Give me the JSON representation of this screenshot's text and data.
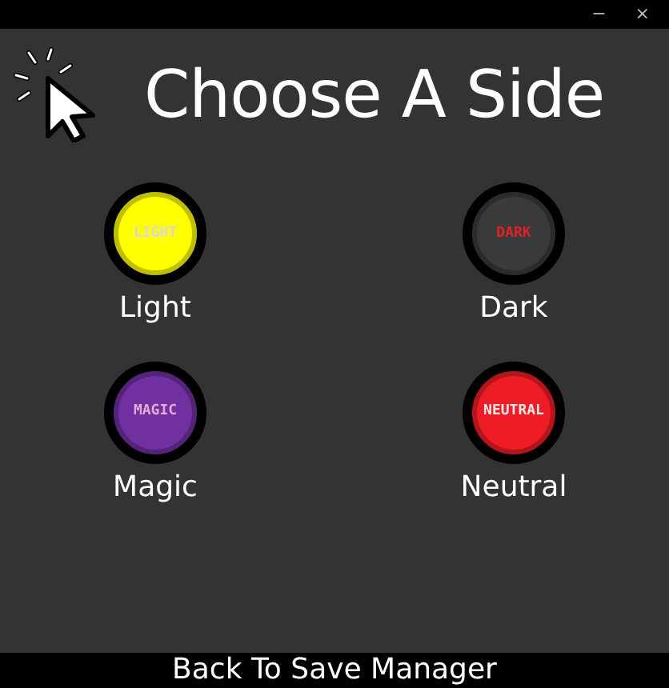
{
  "window": {
    "controls": [
      "−",
      "×"
    ]
  },
  "title": "Choose A Side",
  "sides": [
    {
      "badge": {
        "text": "LIGHT",
        "color": "#d8d8d8"
      },
      "label": "Light",
      "color": "#ffff00"
    },
    {
      "badge": {
        "text": "DARK",
        "color": "#e0202a"
      },
      "label": "Dark",
      "color": "#3a3a3a"
    },
    {
      "badge": {
        "text": "MAGIC",
        "color": "#e8a8d8"
      },
      "label": "Magic",
      "color": "#7030a0"
    },
    {
      "badge": {
        "text": "NEUTRAL",
        "color": "#ffe8e8"
      },
      "label": "Neutral",
      "color": "#ee1c24"
    }
  ],
  "footer": "Back To Save Manager"
}
